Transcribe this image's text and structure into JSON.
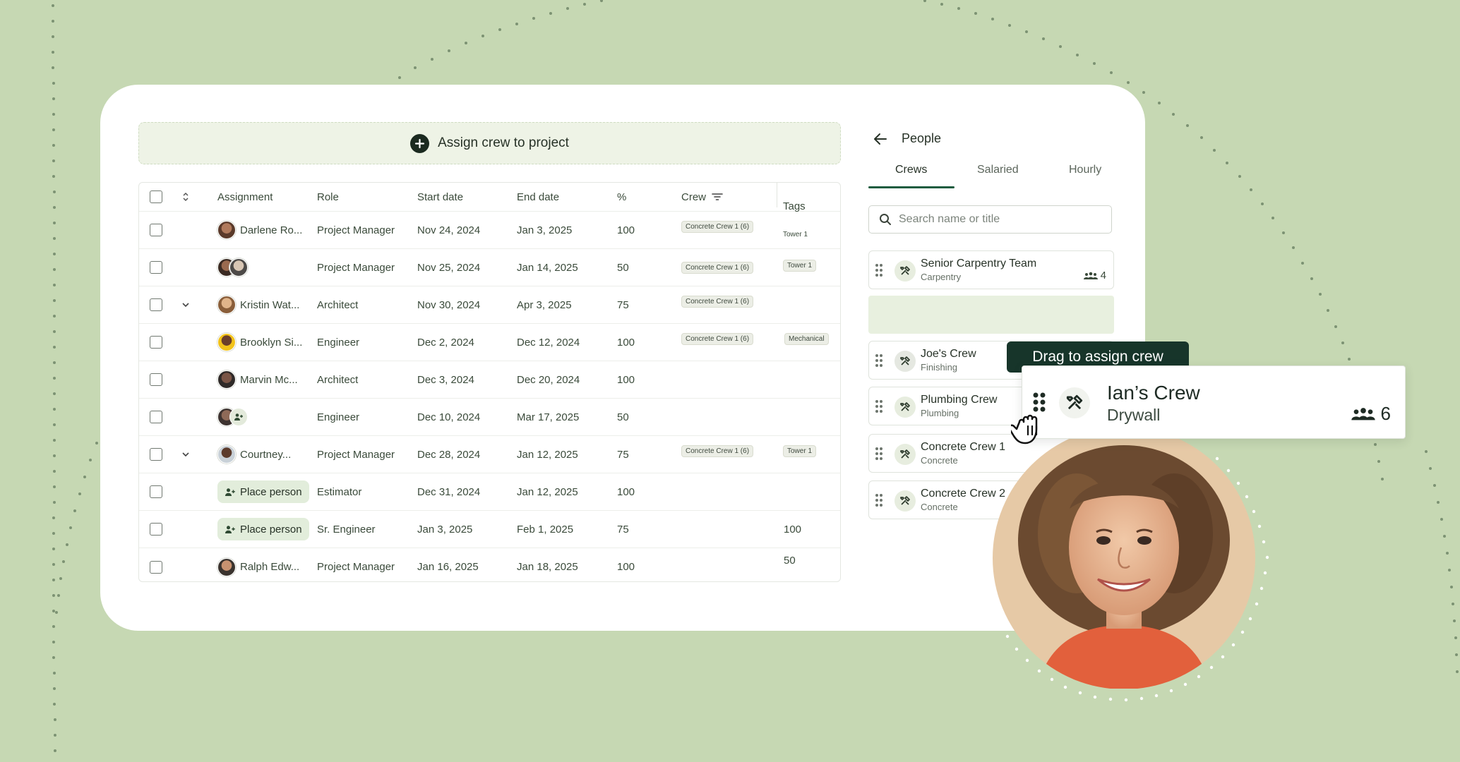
{
  "assign_bar": {
    "label": "Assign crew to project"
  },
  "table": {
    "headers": {
      "assignment": "Assignment",
      "role": "Role",
      "start": "Start date",
      "end": "End date",
      "pct": "%",
      "crew": "Crew",
      "tags": "Tags"
    },
    "rows": [
      {
        "name": "Darlene Ro...",
        "role": "Project Manager",
        "start": "Nov 24, 2024",
        "end": "Jan 3, 2025",
        "pct": "100",
        "crew": "Concrete Crew 1 (6)",
        "tag": "Tower 1"
      },
      {
        "name": "",
        "role": "Project Manager",
        "start": "Nov 25, 2024",
        "end": "Jan 14, 2025",
        "pct": "50",
        "crew": "Concrete Crew 1 (6)",
        "tag": "Tower 1"
      },
      {
        "name": "Kristin Wat...",
        "role": "Architect",
        "start": "Nov 30, 2024",
        "end": "Apr 3, 2025",
        "pct": "75",
        "crew": "Concrete Crew 1 (6)",
        "tag": ""
      },
      {
        "name": "Brooklyn Si...",
        "role": "Engineer",
        "start": "Dec 2, 2024",
        "end": "Dec 12, 2024",
        "pct": "100",
        "crew": "Concrete Crew 1 (6)",
        "tag": "Mechanical"
      },
      {
        "name": "Marvin Mc...",
        "role": "Architect",
        "start": "Dec 3, 2024",
        "end": "Dec 20, 2024",
        "pct": "100",
        "crew": "",
        "tag": ""
      },
      {
        "name": "",
        "role": "Engineer",
        "start": "Dec 10, 2024",
        "end": "Mar 17, 2025",
        "pct": "50",
        "crew": "",
        "tag": ""
      },
      {
        "name": "Courtney...",
        "role": "Project Manager",
        "start": "Dec 28, 2024",
        "end": "Jan 12, 2025",
        "pct": "75",
        "crew": "Concrete Crew 1 (6)",
        "tag": "Tower 1"
      },
      {
        "name": "Place person",
        "role": "Estimator",
        "start": "Dec 31, 2024",
        "end": "Jan 12, 2025",
        "pct": "100",
        "crew": "",
        "tag": ""
      },
      {
        "name": "Place person",
        "role": "Sr. Engineer",
        "start": "Jan 3, 2025",
        "end": "Feb 1, 2025",
        "pct": "75",
        "crew": "",
        "tag": "100"
      },
      {
        "name": "Ralph Edw...",
        "role": "Project Manager",
        "start": "Jan 16, 2025",
        "end": "Jan 18, 2025",
        "pct": "100",
        "crew": "",
        "tag": "50"
      }
    ]
  },
  "people_panel": {
    "title": "People",
    "tabs": [
      "Crews",
      "Salaried",
      "Hourly"
    ],
    "active_tab": "Crews",
    "search_placeholder": "Search name or title",
    "crews": [
      {
        "name": "Senior Carpentry Team",
        "trade": "Carpentry",
        "count": "4"
      },
      {
        "name": "Joe's Crew",
        "trade": "Finishing"
      },
      {
        "name": "Plumbing Crew",
        "trade": "Plumbing"
      },
      {
        "name": "Concrete Crew 1",
        "trade": "Concrete"
      },
      {
        "name": "Concrete Crew 2",
        "trade": "Concrete"
      }
    ]
  },
  "drag": {
    "tooltip": "Drag to assign crew",
    "card": {
      "name": "Ian’s Crew",
      "trade": "Drywall",
      "count": "6"
    }
  },
  "colors": {
    "background": "#c6d8b3",
    "accent_dark": "#17352a",
    "tab_underline": "#1c5c3f",
    "placeholder_green": "#e8f0df"
  }
}
